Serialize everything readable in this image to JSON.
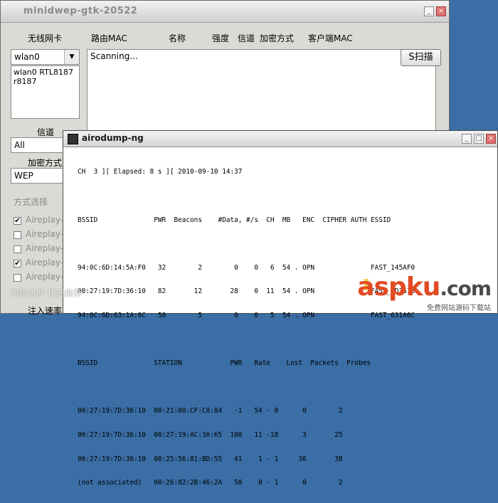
{
  "back_window": {
    "title": "minidwep-gtk-20522",
    "headers": {
      "nic": "无线网卡",
      "router_mac": "路由MAC",
      "name": "名称",
      "strength": "强度",
      "channel": "信道",
      "encryption": "加密方式",
      "client_mac": "客户端MAC"
    },
    "nic_select": "wlan0",
    "nic_info_line1": "wlan0 RTL8187",
    "nic_info_line2": "r8187",
    "status_text": "Scanning...",
    "scan_button": "S扫描",
    "channel_label": "信道",
    "channel_select": "All",
    "encryption_label": "加密方式",
    "encryption_select": "WEP",
    "method_group": "方式选择",
    "methods": [
      {
        "label": "Aireplay-r",
        "checked": true
      },
      {
        "label": "Aireplay-r",
        "checked": false
      },
      {
        "label": "Aireplay-r",
        "checked": false
      },
      {
        "label": "Aireplay-r",
        "checked": true
      },
      {
        "label": "Aireplay-r",
        "checked": false
      }
    ],
    "inject_rate_label": "注入速率"
  },
  "front_window": {
    "title": "airodump-ng",
    "status_line": "CH  3 ][ Elapsed: 8 s ][ 2010-09-10 14:37",
    "ap_header": "BSSID              PWR  Beacons    #Data, #/s  CH  MB   ENC  CIPHER AUTH ESSID",
    "ap_rows": [
      "94:0C:6D:14:5A:F0   32        2        0    0   6  54 . OPN              FAST_145AF0",
      "00:27:19:7D:36:10   82       12       28    0  11  54 . OPN              FAST_7D3610",
      "94:0C:6D:63:1A:6C   50        5        0    0   5  54 . OPN              FAST_631A6C"
    ],
    "client_header": "BSSID              STATION            PWR   Rate    Lost  Packets  Probes",
    "client_rows": [
      "00:27:19:7D:36:10  00:21:00:CF:C0:84   -1   54 - 0      0        2",
      "00:27:19:7D:36:10  00:27:19:AC:3A:65  100   11 -18      3       25",
      "00:27:19:7D:36:10  00:25:56:81:BD:55   41    1 - 1     36       38",
      "(not associated)   00:26:82:2B:46:2A   50    0 - 1      0        2"
    ]
  },
  "watermark": {
    "left_text": "风隐水畔  精品推荐",
    "brand": "aspku",
    "brand_tld": ".com",
    "tagline": "免费网站源码下载站"
  },
  "colors": {
    "desktop": "#3a6ea5",
    "window_bg": "#dcdad5",
    "brand": "#e24a23"
  }
}
